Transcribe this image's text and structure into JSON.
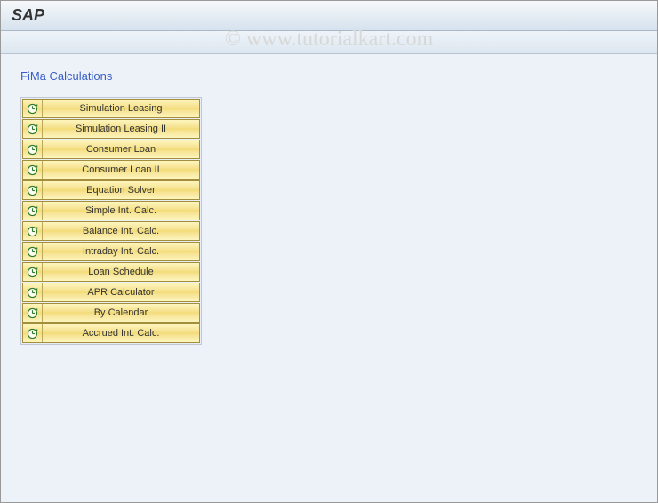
{
  "titlebar": {
    "title": "SAP"
  },
  "watermark": "© www.tutorialkart.com",
  "section": {
    "title": "FiMa Calculations"
  },
  "buttons": [
    {
      "label": "Simulation Leasing"
    },
    {
      "label": "Simulation Leasing II"
    },
    {
      "label": "Consumer Loan"
    },
    {
      "label": "Consumer Loan II"
    },
    {
      "label": "Equation Solver"
    },
    {
      "label": "Simple Int. Calc."
    },
    {
      "label": "Balance Int. Calc."
    },
    {
      "label": "Intraday Int. Calc."
    },
    {
      "label": "Loan Schedule"
    },
    {
      "label": "APR Calculator"
    },
    {
      "label": "By Calendar"
    },
    {
      "label": "Accrued Int. Calc."
    }
  ]
}
